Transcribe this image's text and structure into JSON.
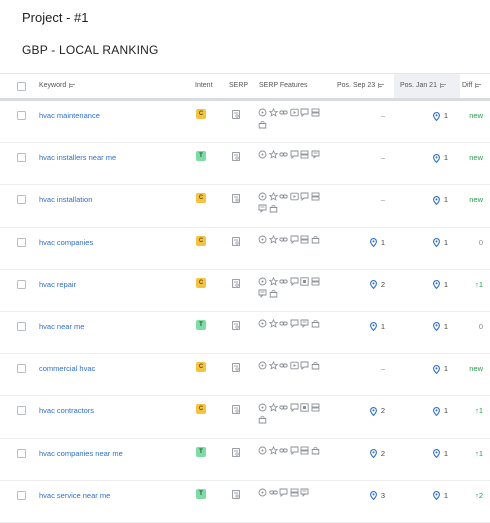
{
  "project": {
    "title": "Project - #1"
  },
  "section": {
    "title": "GBP - LOCAL RANKING"
  },
  "colors": {
    "link": "#2f6fcc",
    "commercial": "#f4c342",
    "transactional": "#7fdca4",
    "positive": "#2a9b4c",
    "pin": "#2f6fcc"
  },
  "table": {
    "headers": {
      "keyword": "Keyword",
      "intent": "Intent",
      "serp": "SERP",
      "serp_features": "SERP Features",
      "pos_sep": "Pos. Sep 23",
      "pos_jan": "Pos. Jan 21",
      "diff": "Diff"
    },
    "rows": [
      {
        "keyword": "hvac maintenance",
        "intent": "C",
        "features": [
          "target",
          "star",
          "link",
          "video",
          "comment",
          "images",
          "shop"
        ],
        "pos_sep": "–",
        "pos_jan": "1",
        "diff": "new"
      },
      {
        "keyword": "hvac installers near me",
        "intent": "T",
        "features": [
          "target",
          "star",
          "link",
          "comment",
          "images",
          "reviews"
        ],
        "pos_sep": "–",
        "pos_jan": "1",
        "diff": "new"
      },
      {
        "keyword": "hvac installation",
        "intent": "C",
        "features": [
          "target",
          "star",
          "link",
          "video",
          "comment",
          "images",
          "reviews",
          "shop"
        ],
        "pos_sep": "–",
        "pos_jan": "1",
        "diff": "new"
      },
      {
        "keyword": "hvac companies",
        "intent": "C",
        "features": [
          "target",
          "star",
          "link",
          "comment",
          "images",
          "shop"
        ],
        "pos_sep": "1",
        "pos_jan": "1",
        "diff": "0"
      },
      {
        "keyword": "hvac repair",
        "intent": "C",
        "features": [
          "target",
          "star",
          "link",
          "comment",
          "gallery",
          "images",
          "reviews",
          "shop"
        ],
        "pos_sep": "2",
        "pos_jan": "1",
        "diff": "↑1"
      },
      {
        "keyword": "hvac near me",
        "intent": "T",
        "features": [
          "target",
          "star",
          "link",
          "comment",
          "reviews",
          "shop"
        ],
        "pos_sep": "1",
        "pos_jan": "1",
        "diff": "0"
      },
      {
        "keyword": "commercial hvac",
        "intent": "C",
        "features": [
          "target",
          "star",
          "link",
          "video",
          "comment",
          "shop"
        ],
        "pos_sep": "–",
        "pos_jan": "1",
        "diff": "new"
      },
      {
        "keyword": "hvac contractors",
        "intent": "C",
        "features": [
          "target",
          "star",
          "link",
          "comment",
          "gallery",
          "images",
          "shop"
        ],
        "pos_sep": "2",
        "pos_jan": "1",
        "diff": "↑1"
      },
      {
        "keyword": "hvac companies near me",
        "intent": "T",
        "features": [
          "target",
          "star",
          "link",
          "comment",
          "images",
          "shop"
        ],
        "pos_sep": "2",
        "pos_jan": "1",
        "diff": "↑1"
      },
      {
        "keyword": "hvac service near me",
        "intent": "T",
        "features": [
          "target",
          "link",
          "comment",
          "images",
          "reviews"
        ],
        "pos_sep": "3",
        "pos_jan": "1",
        "diff": "↑2"
      }
    ]
  }
}
